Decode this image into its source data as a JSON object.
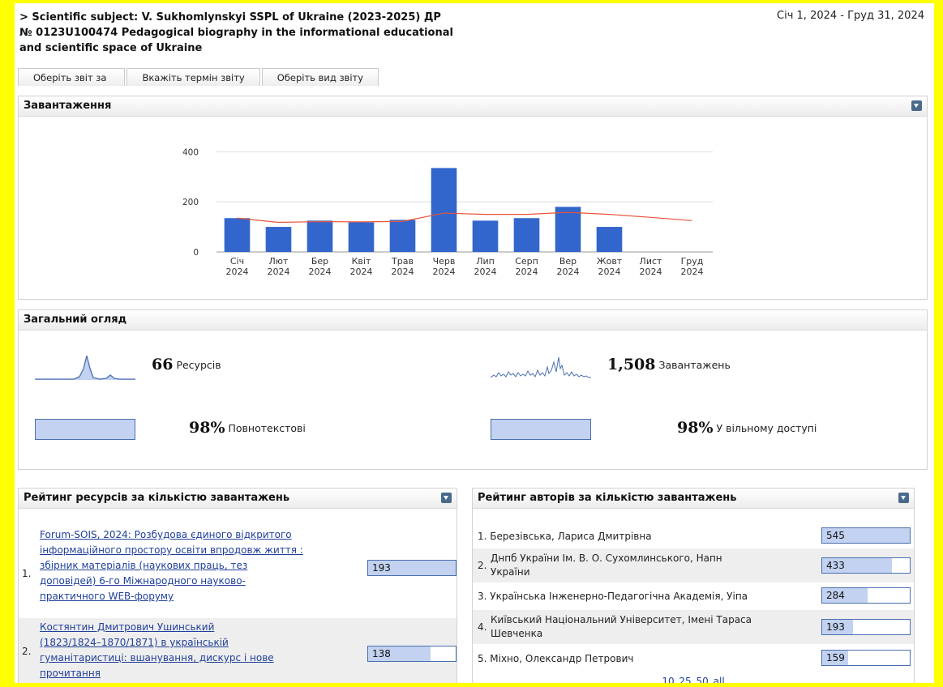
{
  "header": {
    "subject_line1": "> Scientific subject: V. Sukhomlynskyi SSPL of Ukraine (2023-2025) ДР",
    "subject_line2": "№ 0123U100474 Pedagogical biography in the informational educational",
    "subject_line3": "and scientific space of Ukraine",
    "date_range": "Січ 1, 2024 - Груд 31, 2024"
  },
  "tabs": [
    "Оберіть звіт за",
    "Вкажіть термін звіту",
    "Оберіть вид звіту"
  ],
  "downloads_panel": {
    "title": "Завантаження"
  },
  "chart_data": {
    "type": "bar",
    "categories": [
      "Січ\n2024",
      "Лют\n2024",
      "Бер\n2024",
      "Квіт\n2024",
      "Трав\n2024",
      "Черв\n2024",
      "Лип\n2024",
      "Серп\n2024",
      "Вер\n2024",
      "Жовт\n2024",
      "Лист\n2024",
      "Груд\n2024"
    ],
    "series": [
      {
        "type": "bar",
        "values": [
          135,
          100,
          125,
          118,
          128,
          335,
          125,
          135,
          180,
          100,
          0,
          0
        ],
        "color": "#3366cc"
      },
      {
        "type": "line",
        "values": [
          135,
          118,
          121,
          120,
          122,
          155,
          150,
          150,
          158,
          150,
          138,
          125
        ],
        "color": "#e8533a"
      }
    ],
    "yticks": [
      0,
      200,
      400
    ],
    "ylim": [
      0,
      430
    ]
  },
  "overview": {
    "title": "Загальний огляд",
    "resources_count": "66",
    "resources_label": "Ресурсів",
    "downloads_count": "1,508",
    "downloads_label": "Завантажень",
    "fulltext_pct": "98%",
    "fulltext_label": "Повнотекстові",
    "openaccess_pct": "98%",
    "openaccess_label": "У вільному доступі",
    "fulltext_fraction": 0.98,
    "openaccess_fraction": 0.98
  },
  "resources_panel": {
    "title": "Рейтинг ресурсів за кількістю завантажень",
    "items": [
      {
        "rank": "1.",
        "lines": [
          "Forum-SOIS, 2024: Розбудова єдиного відкритого",
          "інформаційного простору освіти впродовж життя :",
          "збірник матеріалів (наукових праць, тез",
          "доповідей) 6-го Міжнародного науково-",
          "практичного WEB-форуму"
        ],
        "count": "193",
        "fraction": 1.0
      },
      {
        "rank": "2.",
        "lines": [
          "Костянтин Дмитрович Ушинський",
          "(1823/1824–1870/1871) в українській",
          "гуманітаристиці: вшанування, дискурс і нове",
          "прочитання"
        ],
        "count": "138",
        "fraction": 0.715
      }
    ]
  },
  "authors_panel": {
    "title": "Рейтинг авторів за кількістю завантажень",
    "items": [
      {
        "lines": [
          "1. Березівська, Лариса Дмитрівна"
        ],
        "count": "545",
        "fraction": 1.0
      },
      {
        "lines": [
          "Днпб України Ім. В. О. Сухомлинського, Напн",
          "України"
        ],
        "rank": "2.",
        "count": "433",
        "fraction": 0.795
      },
      {
        "lines": [
          "3. Українська Інженерно-Педагогічна Академія, Уіпа"
        ],
        "count": "284",
        "fraction": 0.521
      },
      {
        "lines": [
          "Київський Національний Університет, Імені Тараса",
          "Шевченка"
        ],
        "rank": "4.",
        "count": "193",
        "fraction": 0.354
      },
      {
        "lines": [
          "5. Міхно, Олександр Петрович"
        ],
        "count": "159",
        "fraction": 0.292
      }
    ],
    "pager": [
      "10",
      "25",
      "50",
      "all"
    ]
  }
}
